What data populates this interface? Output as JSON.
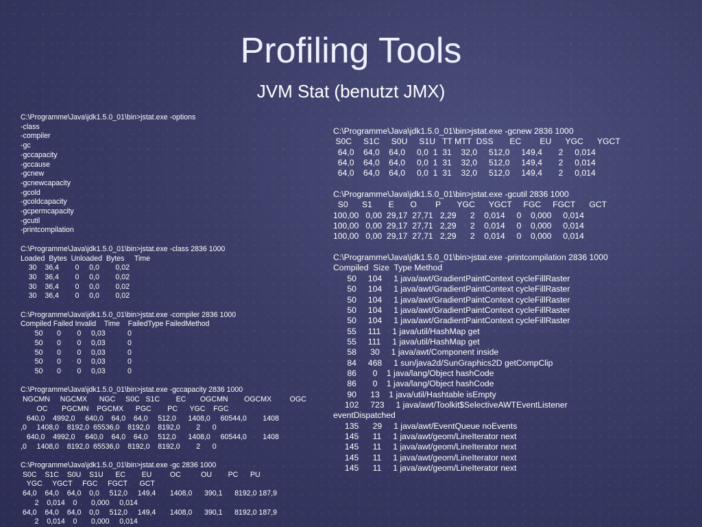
{
  "slide": {
    "title": "Profiling Tools",
    "subtitle": "JVM Stat (benutzt JMX)"
  },
  "left_column": [
    "C:\\Programme\\Java\\jdk1.5.0_01\\bin>jstat.exe -options",
    "-class",
    "-compiler",
    "-gc",
    "-gccapacity",
    "-gccause",
    "-gcnew",
    "-gcnewcapacity",
    "-gcold",
    "-gcoldcapacity",
    "-gcpermcapacity",
    "-gcutil",
    "-printcompilation",
    "",
    "C:\\Programme\\Java\\jdk1.5.0_01\\bin>jstat.exe -class 2836 1000",
    "Loaded  Bytes  Unloaded  Bytes     Time",
    "    30    36,4        0     0,0        0,02",
    "    30    36,4        0     0,0        0,02",
    "    30    36,4        0     0,0        0,02",
    "    30    36,4        0     0,0        0,02",
    "",
    "C:\\Programme\\Java\\jdk1.5.0_01\\bin>jstat.exe -compiler 2836 1000",
    "Compiled Failed Invalid    Time    FailedType FailedMethod",
    "       50       0        0     0,03           0",
    "       50       0        0     0,03           0",
    "       50       0        0     0,03           0",
    "       50       0        0     0,03           0",
    "       50       0        0     0,03           0",
    "",
    "C:\\Programme\\Java\\jdk1.5.0_01\\bin>jstat.exe -gccapacity 2836 1000",
    " NGCMN     NGCMX      NGC     S0C   S1C        EC       OGCMN        OGCMX         OGC",
    "        OC       PGCMN    PGCMX      PGC        PC      YGC    FGC",
    "   640,0    4992,0     640,0    64,0    64,0     512,0      1408,0     60544,0        1408",
    ",0     1408,0    8192,0  65536,0    8192,0    8192,0        2      0",
    "   640,0    4992,0     640,0    64,0    64,0     512,0      1408,0     60544,0        1408",
    ",0     1408,0    8192,0  65536,0    8192,0    8192,0        2      0",
    "",
    "C:\\Programme\\Java\\jdk1.5.0_01\\bin>jstat.exe -gc 2836 1000",
    " S0C    S1C    S0U    S1U      EC        EU         OC          OU        PC      PU",
    "   YGC     YGCT     FGC     FGCT      GCT",
    " 64,0    64,0    64,0    0,0     512,0     149,4       1408,0      390,1      8192,0 187,9",
    "       2    0,014    0       0,000     0,014",
    " 64,0    64,0    64,0    0,0     512,0     149,4       1408,0      390,1      8192,0 187,9",
    "       2    0,014    0       0,000     0,014"
  ],
  "right_column": [
    "C:\\Programme\\Java\\jdk1.5.0_01\\bin>jstat.exe -gcnew 2836 1000",
    " S0C     S1C     S0U     S1U   TT MTT  DSS       EC        EU      YGC      YGCT",
    "  64,0    64,0    64,0     0,0  1  31    32,0     512,0     149,4       2     0,014",
    "  64,0    64,0    64,0     0,0  1  31    32,0     512,0     149,4       2     0,014",
    "  64,0    64,0    64,0     0,0  1  31    32,0     512,0     149,4       2     0,014",
    "",
    "C:\\Programme\\Java\\jdk1.5.0_01\\bin>jstat.exe -gcutil 2836 1000",
    "  S0      S1       E       O        P       YGC      YGCT     FGC     FGCT      GCT",
    "100,00   0,00  29,17  27,71   2,29      2    0,014     0    0,000     0,014",
    "100,00   0,00  29,17  27,71   2,29      2    0,014     0    0,000     0,014",
    "100,00   0,00  29,17  27,71   2,29      2    0,014     0    0,000     0,014",
    "",
    "C:\\Programme\\Java\\jdk1.5.0_01\\bin>jstat.exe -printcompilation 2836 1000",
    "Compiled  Size  Type Method",
    "      50     104     1 java/awt/GradientPaintContext cycleFillRaster",
    "      50     104     1 java/awt/GradientPaintContext cycleFillRaster",
    "      50     104     1 java/awt/GradientPaintContext cycleFillRaster",
    "      50     104     1 java/awt/GradientPaintContext cycleFillRaster",
    "      50     104     1 java/awt/GradientPaintContext cycleFillRaster",
    "      55     111     1 java/util/HashMap get",
    "      55     111     1 java/util/HashMap get",
    "      58      30     1 java/awt/Component inside",
    "      84     468     1 sun/java2d/SunGraphics2D getCompClip",
    "      86       0    1 java/lang/Object hashCode",
    "      86       0    1 java/lang/Object hashCode",
    "      90      13    1 java/util/Hashtable isEmpty",
    "     102     723     1 java/awt/Toolkit$SelectiveAWTEventListener",
    "eventDispatched",
    "     135      29     1 java/awt/EventQueue noEvents",
    "     145      11     1 java/awt/geom/LineIterator next",
    "     145      11     1 java/awt/geom/LineIterator next",
    "     145      11     1 java/awt/geom/LineIterator next",
    "     145      11     1 java/awt/geom/LineIterator next"
  ]
}
